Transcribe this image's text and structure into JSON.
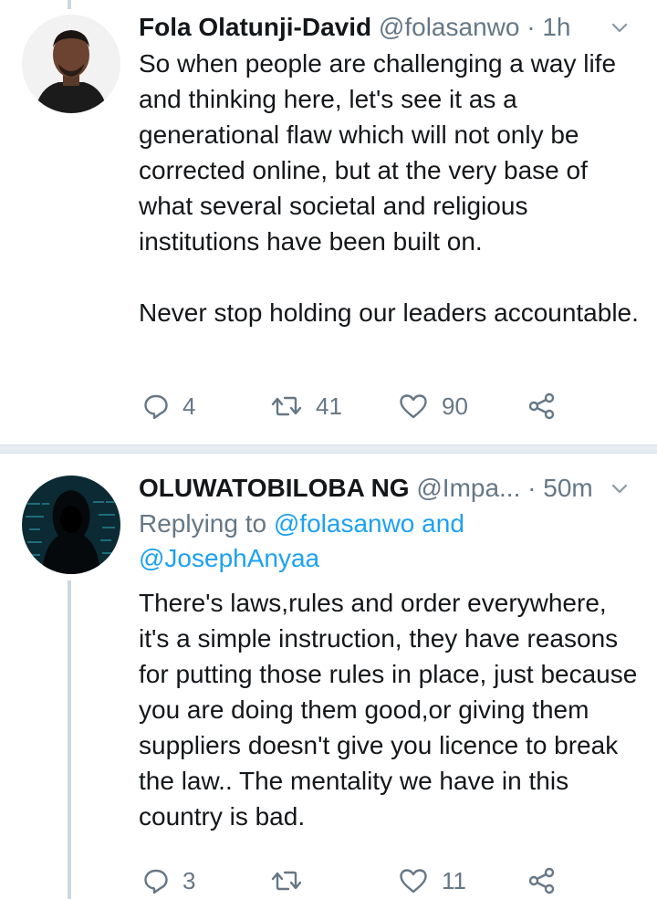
{
  "tweets": [
    {
      "name": "Fola Olatunji-David",
      "handle": "@folasanwo",
      "separator": "·",
      "time": "1h",
      "text": "So when people are challenging a way life and thinking here, let's see it as a generational flaw which will not only be corrected online, but at the very base of what several societal and religious institutions have been built on.\n\nNever stop holding our leaders accountable.",
      "replies": "4",
      "retweets": "41",
      "likes": "90"
    },
    {
      "name": "OLUWATOBILOBA NG",
      "handle": "@Impa...",
      "separator": "·",
      "time": "50m",
      "replying_prefix": "Replying to",
      "replying_to_1": "@folasanwo",
      "replying_and": "and",
      "replying_to_2": "@JosephAnyaa",
      "text": "There's laws,rules and order everywhere, it's a simple instruction, they have reasons for putting those rules in place, just because you are doing them good,or giving them suppliers doesn't give you licence to break the law.. The mentality we have in this country is bad.",
      "replies": "3",
      "retweets": "",
      "likes": "11"
    }
  ],
  "icons": {
    "reply": "reply-icon",
    "retweet": "retweet-icon",
    "like": "heart-icon",
    "share": "share-icon",
    "more": "chevron-down-icon"
  },
  "colors": {
    "text": "#14171a",
    "secondary": "#657786",
    "link": "#1da1f2",
    "divider": "#e6ecf0"
  }
}
